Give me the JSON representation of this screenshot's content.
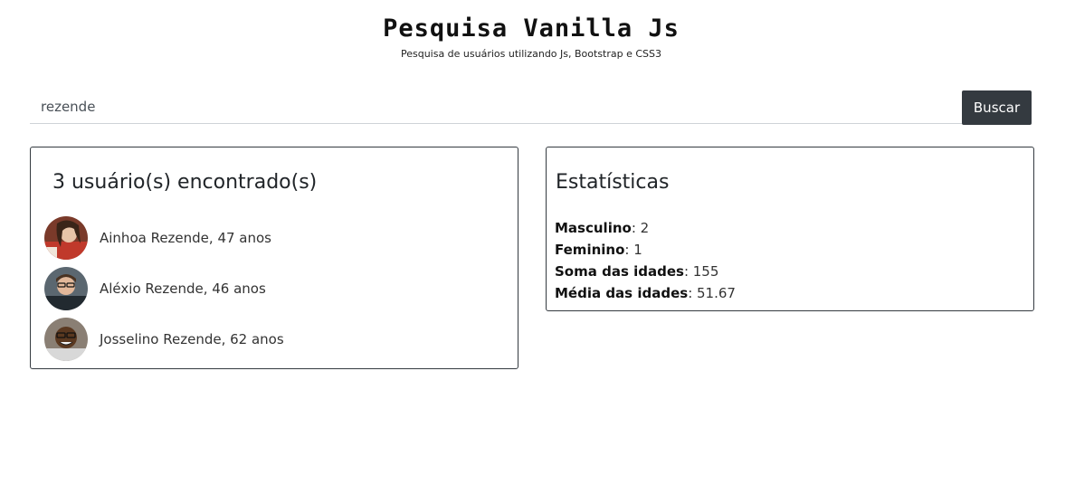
{
  "header": {
    "title": "Pesquisa Vanilla Js",
    "subtitle": "Pesquisa de usuários utilizando Js, Bootstrap e CSS3"
  },
  "search": {
    "value": "rezende",
    "button_label": "Buscar"
  },
  "results": {
    "heading": "3 usuário(s) encontrado(s)",
    "users": [
      {
        "text": "Ainhoa Rezende, 47 anos",
        "avatar": "female-user-avatar"
      },
      {
        "text": "Aléxio Rezende, 46 anos",
        "avatar": "male-user-avatar"
      },
      {
        "text": "Josselino Rezende, 62 anos",
        "avatar": "male-user-avatar"
      }
    ]
  },
  "stats": {
    "heading": "Estatísticas",
    "items": [
      {
        "label": "Masculino",
        "value": "2"
      },
      {
        "label": "Feminino",
        "value": "1"
      },
      {
        "label": "Soma das idades",
        "value": "155"
      },
      {
        "label": "Média das idades",
        "value": "51.67"
      }
    ]
  },
  "colors": {
    "button_bg": "#343a40",
    "card_border": "#343a40"
  }
}
